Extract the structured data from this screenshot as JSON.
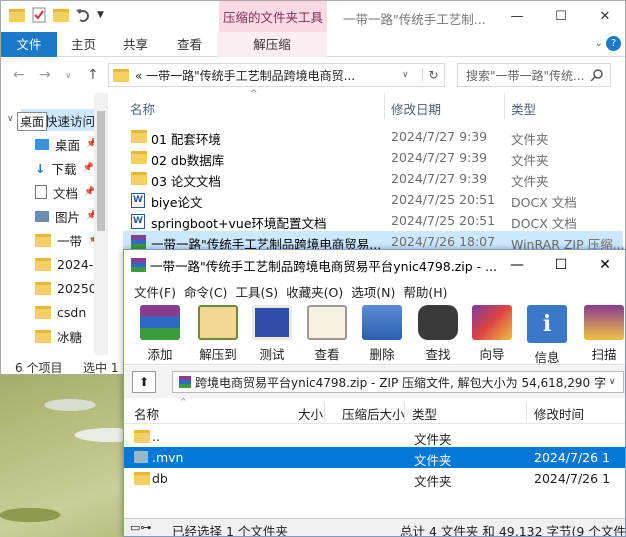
{
  "explorer": {
    "context_tab_title": "压缩的文件夹工具",
    "window_title": "一带一路\"传统手工艺制...",
    "tabs": {
      "file": "文件",
      "home": "主页",
      "share": "共享",
      "view": "查看",
      "extract": "解压缩"
    },
    "address_path": "« 一带一路\"传统手工艺制品跨境电商贸...",
    "search_placeholder": "搜索\"一带一路\"传统...",
    "nav": {
      "quick_access": "快速访问",
      "tooltip_desktop": "桌面",
      "items": [
        "桌面",
        "下载",
        "文档",
        "图片",
        "一带",
        "2024-0",
        "202502",
        "csdn",
        "冰糖"
      ]
    },
    "columns": {
      "name": "名称",
      "date": "修改日期",
      "type": "类型"
    },
    "files": [
      {
        "name": "01 配套环境",
        "date": "2024/7/27 9:39",
        "type": "文件夹",
        "icon": "folder-icon"
      },
      {
        "name": "02 db数据库",
        "date": "2024/7/27 9:39",
        "type": "文件夹",
        "icon": "folder-icon"
      },
      {
        "name": "03 论文文档",
        "date": "2024/7/27 9:39",
        "type": "文件夹",
        "icon": "folder-icon"
      },
      {
        "name": "biye论文",
        "date": "2024/7/25 20:51",
        "type": "DOCX 文档",
        "icon": "docx-icon"
      },
      {
        "name": "springboot+vue环境配置文档",
        "date": "2024/7/25 20:51",
        "type": "DOCX 文档",
        "icon": "docx-icon"
      },
      {
        "name": "一带一路\"传统手工艺制品跨境电商贸易...",
        "date": "2024/7/26 18:07",
        "type": "WinRAR ZIP 压缩...",
        "icon": "winrar-icon"
      }
    ],
    "status": {
      "count": "6 个项目",
      "selected": "选中 1"
    }
  },
  "winrar": {
    "title": "一带一路\"传统手工艺制品跨境电商贸易平台ynic4798.zip - ...",
    "menu": [
      "文件(F)",
      "命令(C)",
      "工具(S)",
      "收藏夹(O)",
      "选项(N)",
      "帮助(H)"
    ],
    "tools": [
      {
        "label": "添加",
        "icon": "add-archive-icon"
      },
      {
        "label": "解压到",
        "icon": "extract-to-icon"
      },
      {
        "label": "测试",
        "icon": "test-icon"
      },
      {
        "label": "查看",
        "icon": "view-icon"
      },
      {
        "label": "删除",
        "icon": "delete-icon"
      },
      {
        "label": "查找",
        "icon": "find-icon"
      },
      {
        "label": "向导",
        "icon": "wizard-icon"
      },
      {
        "label": "信息",
        "icon": "info-icon"
      },
      {
        "label": "扫描",
        "icon": "scan-icon"
      }
    ],
    "path": "跨境电商贸易平台ynic4798.zip - ZIP 压缩文件, 解包大小为 54,618,290 字节",
    "columns": {
      "name": "名称",
      "size": "大小",
      "packed": "压缩后大小",
      "type": "类型",
      "modified": "修改时间"
    },
    "rows": [
      {
        "name": "..",
        "type": "文件夹",
        "modified": ""
      },
      {
        "name": ".mvn",
        "type": "文件夹",
        "modified": "2024/7/26 1"
      },
      {
        "name": "db",
        "type": "文件夹",
        "modified": "2024/7/26 1"
      }
    ],
    "status": {
      "left": "已经选择 1 个文件夹",
      "right": "总计 4 文件夹 和 49,132 字节(9 个文件)"
    }
  }
}
